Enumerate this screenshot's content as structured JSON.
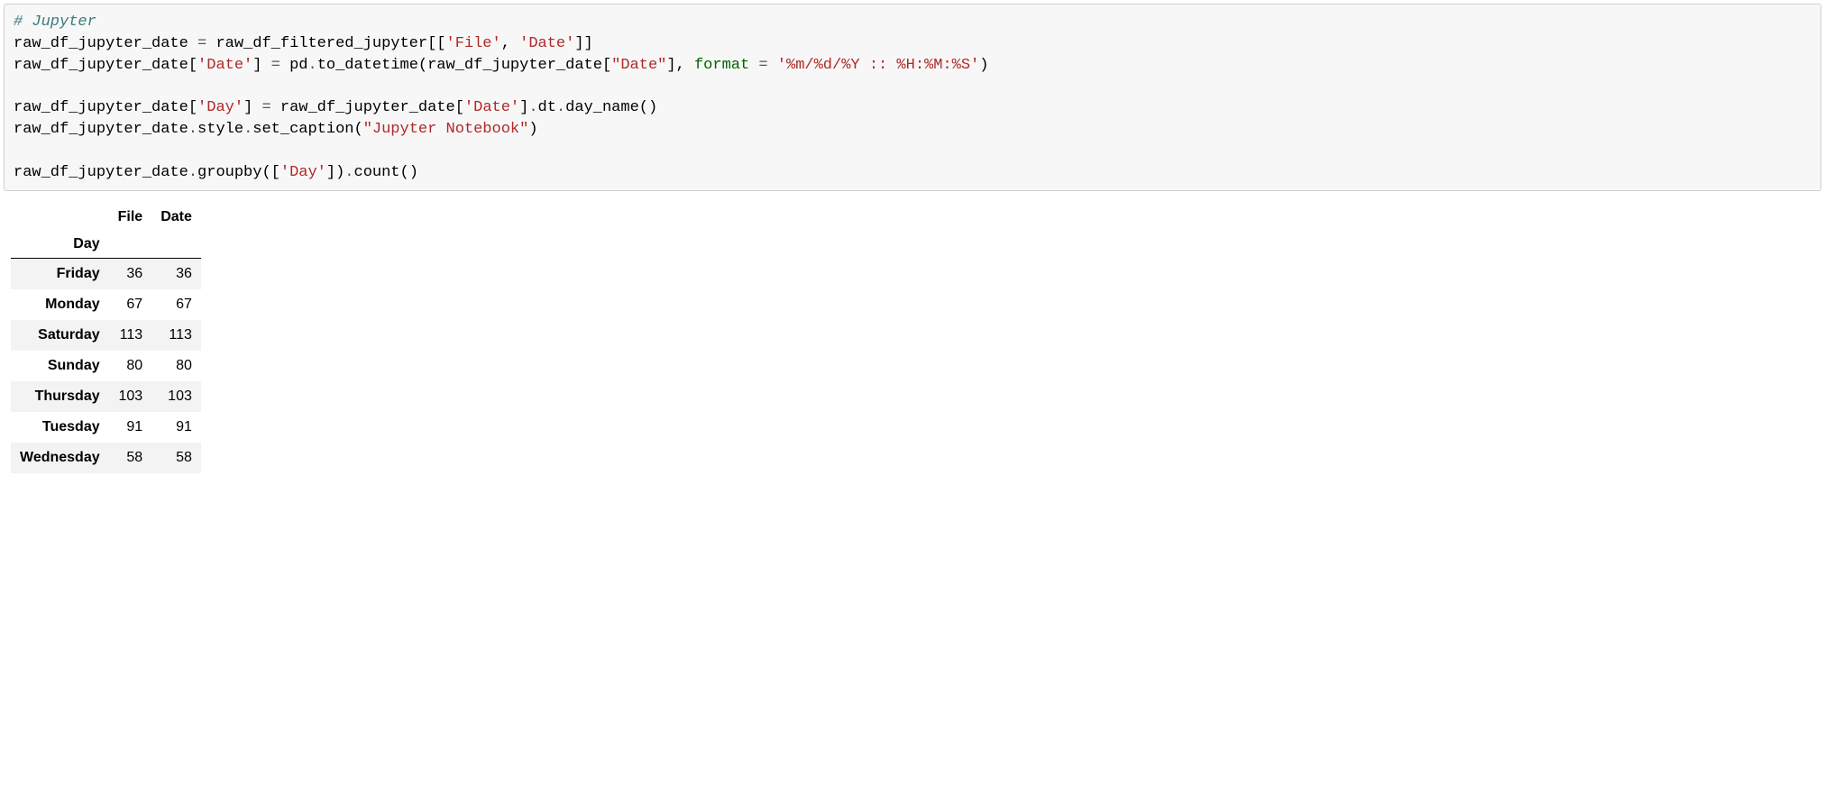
{
  "code": {
    "comment": "# Jupyter",
    "line2_a": "raw_df_jupyter_date ",
    "line2_eq": "=",
    "line2_b": " raw_df_filtered_jupyter[[",
    "line2_s1": "'File'",
    "line2_c": ", ",
    "line2_s2": "'Date'",
    "line2_d": "]]",
    "line3_a": "raw_df_jupyter_date[",
    "line3_s1": "'Date'",
    "line3_b": "] ",
    "line3_eq": "=",
    "line3_c": " pd",
    "line3_dot1": ".",
    "line3_d": "to_datetime(raw_df_jupyter_date[",
    "line3_s2": "\"Date\"",
    "line3_e": "], ",
    "line3_kw": "format",
    "line3_f": " ",
    "line3_eq2": "=",
    "line3_g": " ",
    "line3_s3": "'%m/%d/%Y :: %H:%M:%S'",
    "line3_h": ")",
    "line5_a": "raw_df_jupyter_date[",
    "line5_s1": "'Day'",
    "line5_b": "] ",
    "line5_eq": "=",
    "line5_c": " raw_df_jupyter_date[",
    "line5_s2": "'Date'",
    "line5_d": "]",
    "line5_dot1": ".",
    "line5_e": "dt",
    "line5_dot2": ".",
    "line5_f": "day_name()",
    "line6_a": "raw_df_jupyter_date",
    "line6_dot1": ".",
    "line6_b": "style",
    "line6_dot2": ".",
    "line6_c": "set_caption(",
    "line6_s1": "\"Jupyter Notebook\"",
    "line6_d": ")",
    "line8_a": "raw_df_jupyter_date",
    "line8_dot1": ".",
    "line8_b": "groupby([",
    "line8_s1": "'Day'",
    "line8_c": "])",
    "line8_dot2": ".",
    "line8_d": "count()"
  },
  "table": {
    "columns": [
      "File",
      "Date"
    ],
    "index_name": "Day",
    "rows": [
      {
        "day": "Friday",
        "file": "36",
        "date": "36"
      },
      {
        "day": "Monday",
        "file": "67",
        "date": "67"
      },
      {
        "day": "Saturday",
        "file": "113",
        "date": "113"
      },
      {
        "day": "Sunday",
        "file": "80",
        "date": "80"
      },
      {
        "day": "Thursday",
        "file": "103",
        "date": "103"
      },
      {
        "day": "Tuesday",
        "file": "91",
        "date": "91"
      },
      {
        "day": "Wednesday",
        "file": "58",
        "date": "58"
      }
    ]
  }
}
